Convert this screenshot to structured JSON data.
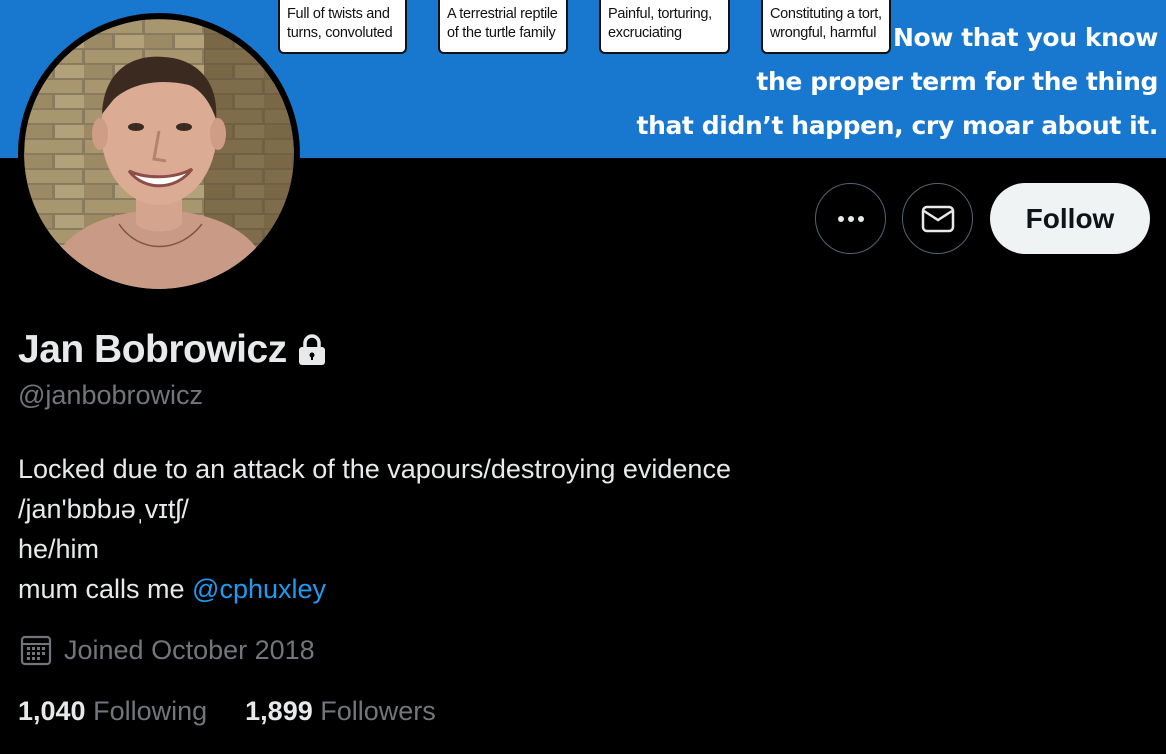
{
  "banner": {
    "cards": [
      {
        "line1": "Full of twists and",
        "line2": "turns, convoluted"
      },
      {
        "line1": "A terrestrial reptile",
        "line2": "of the turtle family"
      },
      {
        "line1": "Painful, torturing,",
        "line2": "excruciating"
      },
      {
        "line1": "Constituting a tort,",
        "line2": "wrongful, harmful"
      }
    ],
    "text_lines": [
      "Now that you know",
      "the proper term for the thing",
      "that didn’t happen, cry moar about it."
    ],
    "color": "#1877cf"
  },
  "actions": {
    "more_icon": "more-horizontal-icon",
    "message_icon": "envelope-icon",
    "follow_label": "Follow"
  },
  "profile": {
    "name": "Jan Bobrowicz",
    "protected_icon": "lock-icon",
    "handle": "@janbobrowicz",
    "bio": {
      "line1": "Locked due to an attack of the vapours/destroying evidence",
      "line2": "/jan'bɒbɹəˌvɪtʃ/",
      "line3": "he/him",
      "line4_prefix": "mum calls me ",
      "mention": "@cphuxley"
    },
    "joined_icon": "calendar-icon",
    "joined": "Joined October 2018",
    "following_count": "1,040",
    "following_label": "Following",
    "followers_count": "1,899",
    "followers_label": "Followers"
  },
  "colors": {
    "background": "#000000",
    "text": "#e7e9ea",
    "muted": "#71767b",
    "link": "#1d9bf0"
  }
}
